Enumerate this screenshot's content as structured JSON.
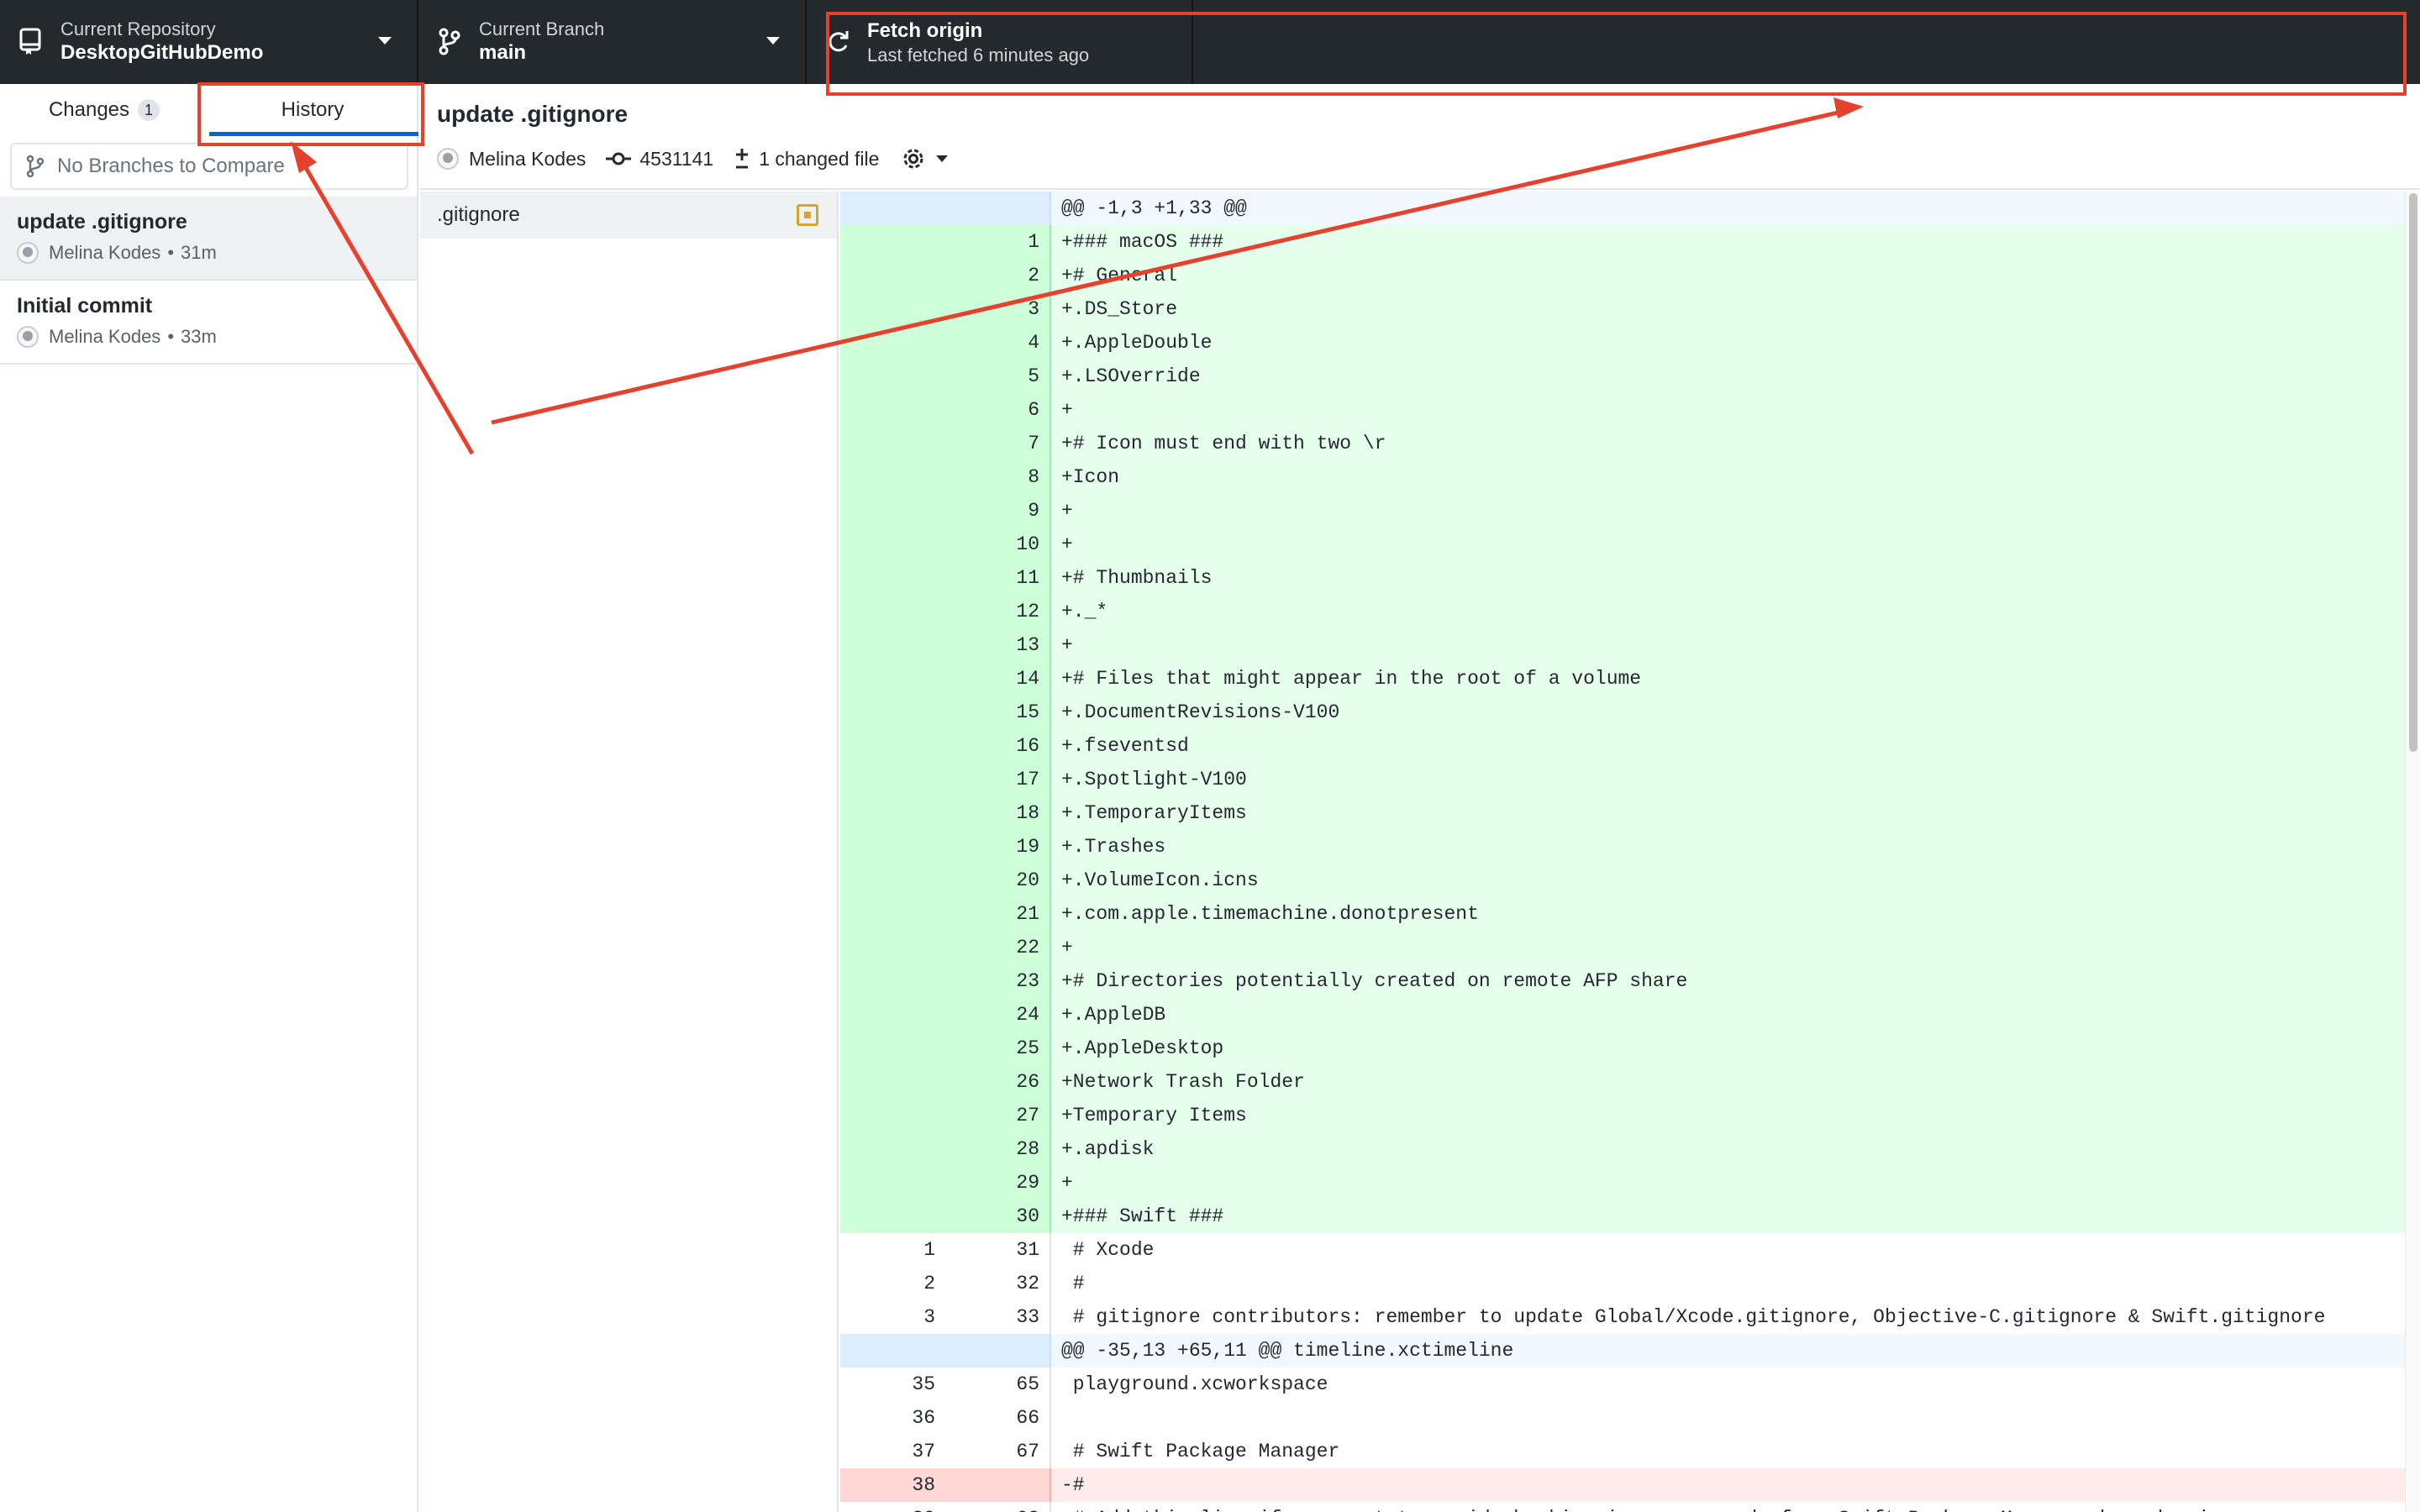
{
  "toolbar": {
    "repo": {
      "label": "Current Repository",
      "value": "DesktopGitHubDemo"
    },
    "branch": {
      "label": "Current Branch",
      "value": "main"
    },
    "fetch": {
      "title": "Fetch origin",
      "subtitle": "Last fetched 6 minutes ago"
    }
  },
  "sidebar": {
    "tabs": [
      {
        "label": "Changes",
        "count": "1"
      },
      {
        "label": "History"
      }
    ],
    "compare_placeholder": "No Branches to Compare",
    "commits": [
      {
        "title": "update .gitignore",
        "author": "Melina Kodes",
        "sep": "•",
        "age": "31m"
      },
      {
        "title": "Initial commit",
        "author": "Melina Kodes",
        "sep": "•",
        "age": "33m"
      }
    ]
  },
  "commit": {
    "summary": "update .gitignore",
    "author": "Melina Kodes",
    "sha": "4531141",
    "files_changed": "1 changed file"
  },
  "files": [
    {
      "name": ".gitignore",
      "status": "modified"
    }
  ],
  "diff": [
    {
      "type": "hunk",
      "old": "",
      "new": "",
      "text": "@@ -1,3 +1,33 @@"
    },
    {
      "type": "add",
      "old": "",
      "new": "1",
      "text": "+### macOS ###"
    },
    {
      "type": "add",
      "old": "",
      "new": "2",
      "text": "+# General"
    },
    {
      "type": "add",
      "old": "",
      "new": "3",
      "text": "+.DS_Store"
    },
    {
      "type": "add",
      "old": "",
      "new": "4",
      "text": "+.AppleDouble"
    },
    {
      "type": "add",
      "old": "",
      "new": "5",
      "text": "+.LSOverride"
    },
    {
      "type": "add",
      "old": "",
      "new": "6",
      "text": "+"
    },
    {
      "type": "add",
      "old": "",
      "new": "7",
      "text": "+# Icon must end with two \\r"
    },
    {
      "type": "add",
      "old": "",
      "new": "8",
      "text": "+Icon"
    },
    {
      "type": "add",
      "old": "",
      "new": "9",
      "text": "+"
    },
    {
      "type": "add",
      "old": "",
      "new": "10",
      "text": "+"
    },
    {
      "type": "add",
      "old": "",
      "new": "11",
      "text": "+# Thumbnails"
    },
    {
      "type": "add",
      "old": "",
      "new": "12",
      "text": "+._*"
    },
    {
      "type": "add",
      "old": "",
      "new": "13",
      "text": "+"
    },
    {
      "type": "add",
      "old": "",
      "new": "14",
      "text": "+# Files that might appear in the root of a volume"
    },
    {
      "type": "add",
      "old": "",
      "new": "15",
      "text": "+.DocumentRevisions-V100"
    },
    {
      "type": "add",
      "old": "",
      "new": "16",
      "text": "+.fseventsd"
    },
    {
      "type": "add",
      "old": "",
      "new": "17",
      "text": "+.Spotlight-V100"
    },
    {
      "type": "add",
      "old": "",
      "new": "18",
      "text": "+.TemporaryItems"
    },
    {
      "type": "add",
      "old": "",
      "new": "19",
      "text": "+.Trashes"
    },
    {
      "type": "add",
      "old": "",
      "new": "20",
      "text": "+.VolumeIcon.icns"
    },
    {
      "type": "add",
      "old": "",
      "new": "21",
      "text": "+.com.apple.timemachine.donotpresent"
    },
    {
      "type": "add",
      "old": "",
      "new": "22",
      "text": "+"
    },
    {
      "type": "add",
      "old": "",
      "new": "23",
      "text": "+# Directories potentially created on remote AFP share"
    },
    {
      "type": "add",
      "old": "",
      "new": "24",
      "text": "+.AppleDB"
    },
    {
      "type": "add",
      "old": "",
      "new": "25",
      "text": "+.AppleDesktop"
    },
    {
      "type": "add",
      "old": "",
      "new": "26",
      "text": "+Network Trash Folder"
    },
    {
      "type": "add",
      "old": "",
      "new": "27",
      "text": "+Temporary Items"
    },
    {
      "type": "add",
      "old": "",
      "new": "28",
      "text": "+.apdisk"
    },
    {
      "type": "add",
      "old": "",
      "new": "29",
      "text": "+"
    },
    {
      "type": "add",
      "old": "",
      "new": "30",
      "text": "+### Swift ###"
    },
    {
      "type": "ctx",
      "old": "1",
      "new": "31",
      "text": " # Xcode"
    },
    {
      "type": "ctx",
      "old": "2",
      "new": "32",
      "text": " #"
    },
    {
      "type": "ctx",
      "old": "3",
      "new": "33",
      "text": " # gitignore contributors: remember to update Global/Xcode.gitignore, Objective-C.gitignore & Swift.gitignore"
    },
    {
      "type": "hunk",
      "old": "",
      "new": "",
      "text": "@@ -35,13 +65,11 @@ timeline.xctimeline"
    },
    {
      "type": "ctx",
      "old": "35",
      "new": "65",
      "text": " playground.xcworkspace"
    },
    {
      "type": "ctx",
      "old": "36",
      "new": "66",
      "text": ""
    },
    {
      "type": "ctx",
      "old": "37",
      "new": "67",
      "text": " # Swift Package Manager"
    },
    {
      "type": "del",
      "old": "38",
      "new": "",
      "text": "-#"
    },
    {
      "type": "ctx",
      "old": "39",
      "new": "68",
      "text": " # Add this line if you want to avoid checking in source code from Swift Package Manager dependencies."
    }
  ],
  "colors": {
    "toolbar_bg": "#24292e",
    "accent": "#0366d6",
    "annotation": "#e5412d",
    "added_bg": "#e6ffec",
    "removed_bg": "#ffebe9"
  },
  "icons": [
    "repo-icon",
    "branch-icon",
    "sync-icon",
    "compare-branch-icon",
    "commit-icon",
    "diff-icon",
    "gear-icon",
    "file-modified-icon"
  ]
}
